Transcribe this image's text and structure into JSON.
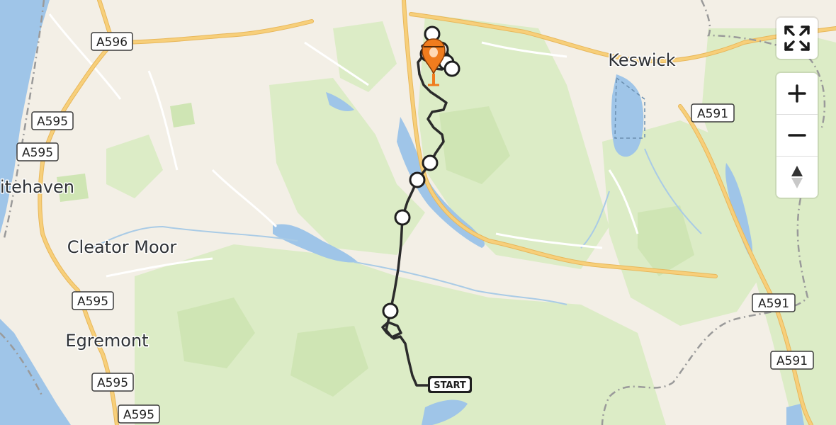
{
  "places": [
    {
      "id": "keswick",
      "label": "Keswick"
    },
    {
      "id": "whitehaven",
      "label": "itehaven"
    },
    {
      "id": "cleator-moor",
      "label": "Cleator Moor"
    },
    {
      "id": "egremont",
      "label": "Egremont"
    }
  ],
  "road_shields": [
    {
      "id": "a596",
      "label": "A596"
    },
    {
      "id": "a595-1",
      "label": "A595"
    },
    {
      "id": "a595-2",
      "label": "A595"
    },
    {
      "id": "a595-3",
      "label": "A595"
    },
    {
      "id": "a595-4",
      "label": "A595"
    },
    {
      "id": "a595-5",
      "label": "A595"
    },
    {
      "id": "a591-1",
      "label": "A591"
    },
    {
      "id": "a591-2",
      "label": "A591"
    },
    {
      "id": "a591-3",
      "label": "A591"
    }
  ],
  "route": {
    "start_label": "START",
    "color": "#2b2b2b",
    "waypoint_count": 9
  },
  "colors": {
    "land": "#f3efe6",
    "forest": "#dcecc6",
    "water": "#9fc5e8",
    "major_road": "#f7cf7a",
    "boundary": "#9a9a9a"
  },
  "controls": {
    "fullscreen_icon": "fullscreen-icon",
    "zoom_in_icon": "plus-icon",
    "zoom_out_icon": "minus-icon",
    "compass_icon": "compass-icon"
  }
}
